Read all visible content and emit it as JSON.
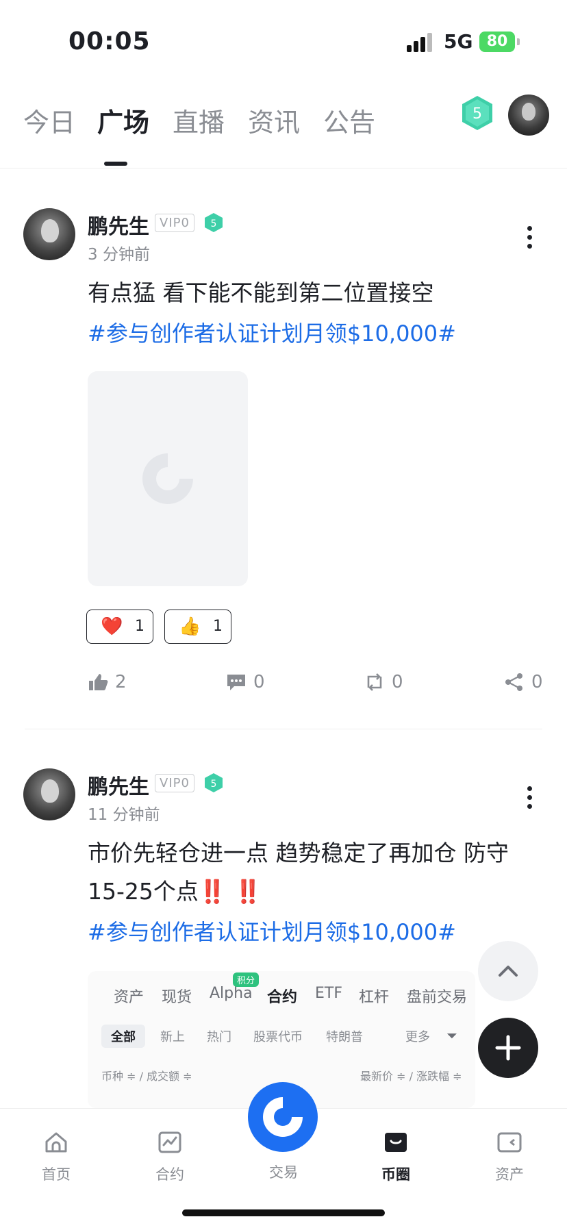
{
  "status_bar": {
    "time": "00:05",
    "network": "5G",
    "battery": "80"
  },
  "tabs": [
    {
      "label": "今日"
    },
    {
      "label": "广场"
    },
    {
      "label": "直播"
    },
    {
      "label": "资讯"
    },
    {
      "label": "公告"
    }
  ],
  "user_level": "5",
  "posts": [
    {
      "author": "鹏先生",
      "vip": "VIP0",
      "level": "5",
      "time_ago": "3 分钟前",
      "content": "有点猛 看下能不能到第二位置接空",
      "hashtag": "#参与创作者认证计划月领$10,000#",
      "reactions": [
        {
          "emoji": "❤️",
          "count": "1"
        },
        {
          "emoji": "👍",
          "count": "1"
        }
      ],
      "likes": "2",
      "comments": "0",
      "reposts": "0",
      "shares": "0"
    },
    {
      "author": "鹏先生",
      "vip": "VIP0",
      "level": "5",
      "time_ago": "11 分钟前",
      "content_line1": "市价先轻仓进一点 趋势稳定了再加仓 防守",
      "content_line2": "15-25个点",
      "content_emoji": "‼️ ‼️",
      "hashtag": "#参与创作者认证计划月领$10,000#",
      "preview": {
        "tabs": [
          "资产",
          "现货",
          "Alpha",
          "合约",
          "ETF",
          "杠杆",
          "盘前交易"
        ],
        "badge": "积分",
        "chips": [
          "全部",
          "新上",
          "热门",
          "股票代币",
          "特朗普",
          "更多"
        ],
        "head_left": "币种 ≑ / 成交额 ≑",
        "head_right": "最新价 ≑ / 涨跌幅 ≑"
      }
    }
  ],
  "bottom_nav": [
    {
      "label": "首页",
      "icon": "home-icon"
    },
    {
      "label": "合约",
      "icon": "chart-icon"
    },
    {
      "label": "交易",
      "icon": "trade-icon"
    },
    {
      "label": "币圈",
      "icon": "square-icon"
    },
    {
      "label": "资产",
      "icon": "wallet-icon"
    }
  ],
  "colors": {
    "accent": "#1d6ff2",
    "hashtag": "#1c6ce6",
    "level": "#3ecfa8"
  }
}
